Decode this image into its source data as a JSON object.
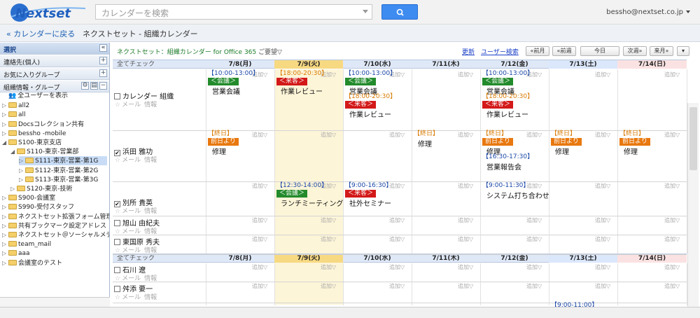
{
  "header": {
    "logo_text": "Nextset",
    "search_placeholder": "カレンダーを検索",
    "user_email": "bessho@nextset.co.jp"
  },
  "breadcrumb": {
    "back_label": "« カレンダーに戻る",
    "title": "ネクストセット - 組織カレンダー"
  },
  "sidebar": {
    "select_label": "選択",
    "contacts_label": "連絡先(個人)",
    "favorites_label": "お気に入りグループ",
    "org_label": "組織情報・グループ",
    "tree": [
      {
        "label": "全ユーザーを表示",
        "indent": 0,
        "toggle": "",
        "folder": false
      },
      {
        "label": "all2",
        "indent": 0,
        "toggle": "▷",
        "folder": true
      },
      {
        "label": "all",
        "indent": 0,
        "toggle": "▷",
        "folder": true
      },
      {
        "label": "Docsコレクション共有",
        "indent": 0,
        "toggle": "▷",
        "folder": true
      },
      {
        "label": "bessho -mobile",
        "indent": 0,
        "toggle": "▷",
        "folder": true
      },
      {
        "label": "S100-東京支店",
        "indent": 0,
        "toggle": "◢",
        "folder": true
      },
      {
        "label": "S110-東京-営業部",
        "indent": 1,
        "toggle": "◢",
        "folder": true
      },
      {
        "label": "S111-東京-営業-第1G",
        "indent": 2,
        "toggle": "▷",
        "folder": true,
        "selected": true
      },
      {
        "label": "S112-東京-営業-第2G",
        "indent": 2,
        "toggle": "▷",
        "folder": true
      },
      {
        "label": "S113-東京-営業-第3G",
        "indent": 2,
        "toggle": "▷",
        "folder": true
      },
      {
        "label": "S120-東京-技術",
        "indent": 1,
        "toggle": "▷",
        "folder": true
      },
      {
        "label": "S900-会議室",
        "indent": 0,
        "toggle": "▷",
        "folder": true
      },
      {
        "label": "S990-受付スタッフ",
        "indent": 0,
        "toggle": "▷",
        "folder": true
      },
      {
        "label": "ネクストセット拡張フォーム管理",
        "indent": 0,
        "toggle": "▷",
        "folder": true
      },
      {
        "label": "共有ブックマーク設定アドレス",
        "indent": 0,
        "toggle": "▷",
        "folder": true
      },
      {
        "label": "ネクストセット＠ソーシャルメディ",
        "indent": 0,
        "toggle": "▷",
        "folder": true
      },
      {
        "label": "team_mail",
        "indent": 0,
        "toggle": "▷",
        "folder": true
      },
      {
        "label": "aaa",
        "indent": 0,
        "toggle": "▷",
        "folder": true
      },
      {
        "label": "会議室のテスト",
        "indent": 0,
        "toggle": "▷",
        "folder": true
      }
    ]
  },
  "toolbar": {
    "title": "ネクストセット：組織カレンダー for Office 365",
    "request": "ご要望▽",
    "refresh": "更新",
    "user_search": "ユーザー検索",
    "prev_month": "«前月",
    "prev_week": "«前週",
    "today": "今日",
    "next_week": "次週»",
    "next_month": "来月»",
    "menu": "▾"
  },
  "calendar": {
    "check_all": "全てチェック",
    "days": [
      "7/8(月)",
      "7/9(火)",
      "7/10(水)",
      "7/11(木)",
      "7/12(金)",
      "7/13(土)",
      "7/14(日)"
    ],
    "add_label": "追加▽",
    "mail_label": "メール",
    "info_label": "情報",
    "users": [
      {
        "name": "カレンダー 組織",
        "checked": false
      },
      {
        "name": "浜田 雅功",
        "checked": true
      },
      {
        "name": "別所 貴英",
        "checked": true
      },
      {
        "name": "旭山 由紀夫",
        "checked": false
      },
      {
        "name": "東国原 秀夫",
        "checked": false
      },
      {
        "name": "石川 遼",
        "checked": false
      },
      {
        "name": "舛添 要一",
        "checked": false
      }
    ],
    "events": {
      "t1": "【10:00-13:00】",
      "tag_meeting": "＜会議＞",
      "e1": "営業会議",
      "t2": "【18:00-20:30】",
      "tag_visitor": "＜来客＞",
      "e2": "作業レビュー",
      "t_holiday": "【終日】",
      "tag_before": "前日より",
      "e_repair": "修理",
      "t3": "【16:30-17:30】",
      "e3": "営業報告会",
      "t4": "【12:30-14:00】",
      "e4": "ランチミーティング",
      "t5": "【9:00-16:30】",
      "e5": "社外セミナー",
      "t6": "【9:00-11:30】",
      "e6": "システム打ち合わせ",
      "t7": "【9:00-11:00】"
    }
  }
}
